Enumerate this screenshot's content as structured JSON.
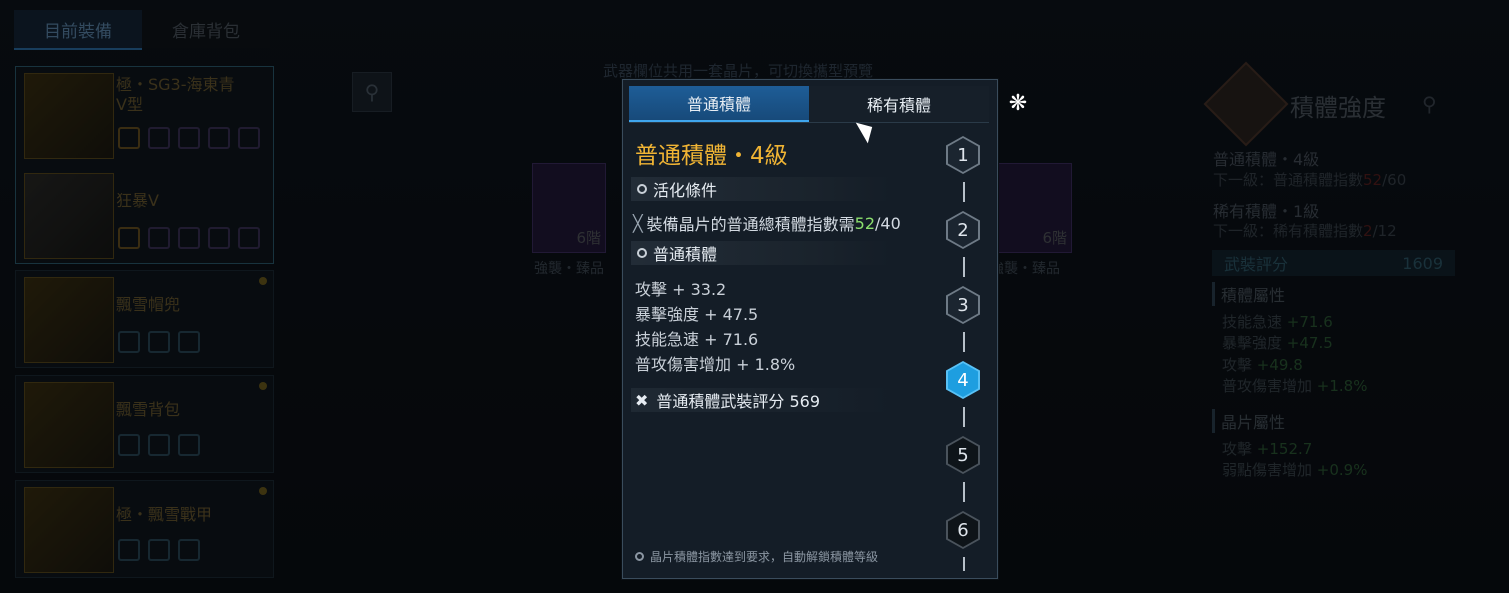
{
  "left": {
    "tabs": [
      "目前裝備",
      "倉庫背包"
    ],
    "slots": [
      {
        "name": "極・SG3-海東青\nV型",
        "grade": "極"
      },
      {
        "name": "狂暴Ⅴ"
      },
      {
        "name": "飄雪帽兜"
      },
      {
        "name": "飄雪背包"
      },
      {
        "name": "極・飄雪戰甲",
        "grade": "極"
      }
    ]
  },
  "middle": {
    "hint": "武器欄位共用一套晶片，可切換攜型預覽",
    "cards": [
      {
        "stage": "6階",
        "label": "強襲・臻品"
      },
      {
        "stage": "6階",
        "label": "強襲・臻品"
      }
    ]
  },
  "right": {
    "title": "積體強度",
    "normal_line": "普通積體・4級",
    "normal_sub_prefix": "下一級：普通積體指數",
    "normal_sub_cur": "52",
    "normal_sub_max": "/60",
    "rare_line": "稀有積體・1級",
    "rare_sub_prefix": "下一級：稀有積體指數",
    "rare_sub_cur": "2",
    "rare_sub_max": "/12",
    "score_label": "武裝評分",
    "score_value": "1609",
    "attr_head": "積體屬性",
    "attrs": [
      {
        "name": "技能急速",
        "value": "+71.6"
      },
      {
        "name": "暴擊強度",
        "value": "+47.5"
      },
      {
        "name": "攻擊",
        "value": "+49.8"
      },
      {
        "name": "普攻傷害增加",
        "value": "+1.8%"
      }
    ],
    "chip_head": "晶片屬性",
    "chip_attrs": [
      {
        "name": "攻擊",
        "value": "+152.7"
      },
      {
        "name": "弱點傷害增加",
        "value": "+0.9%"
      }
    ]
  },
  "modal": {
    "tabs": [
      "普通積體",
      "稀有積體"
    ],
    "title": "普通積體・4級",
    "activation_header": "活化條件",
    "condition_text": "裝備晶片的普通總積體指數需",
    "condition_current": "52",
    "condition_required": "/40",
    "stats_header": "普通積體",
    "stats": [
      "攻擊 + 33.2",
      "暴擊強度 + 47.5",
      "技能急速 + 71.6",
      "普攻傷害增加 + 1.8%"
    ],
    "score_text": "普通積體武裝評分 569",
    "footer_note": "晶片積體指數達到要求，自動解鎖積體等級",
    "levels": [
      "1",
      "2",
      "3",
      "4",
      "5",
      "6"
    ],
    "current_level": 4
  },
  "colors": {
    "accent_blue": "#1e9ee0",
    "title_gold": "#f0b434",
    "value_green": "#8ce06e"
  }
}
